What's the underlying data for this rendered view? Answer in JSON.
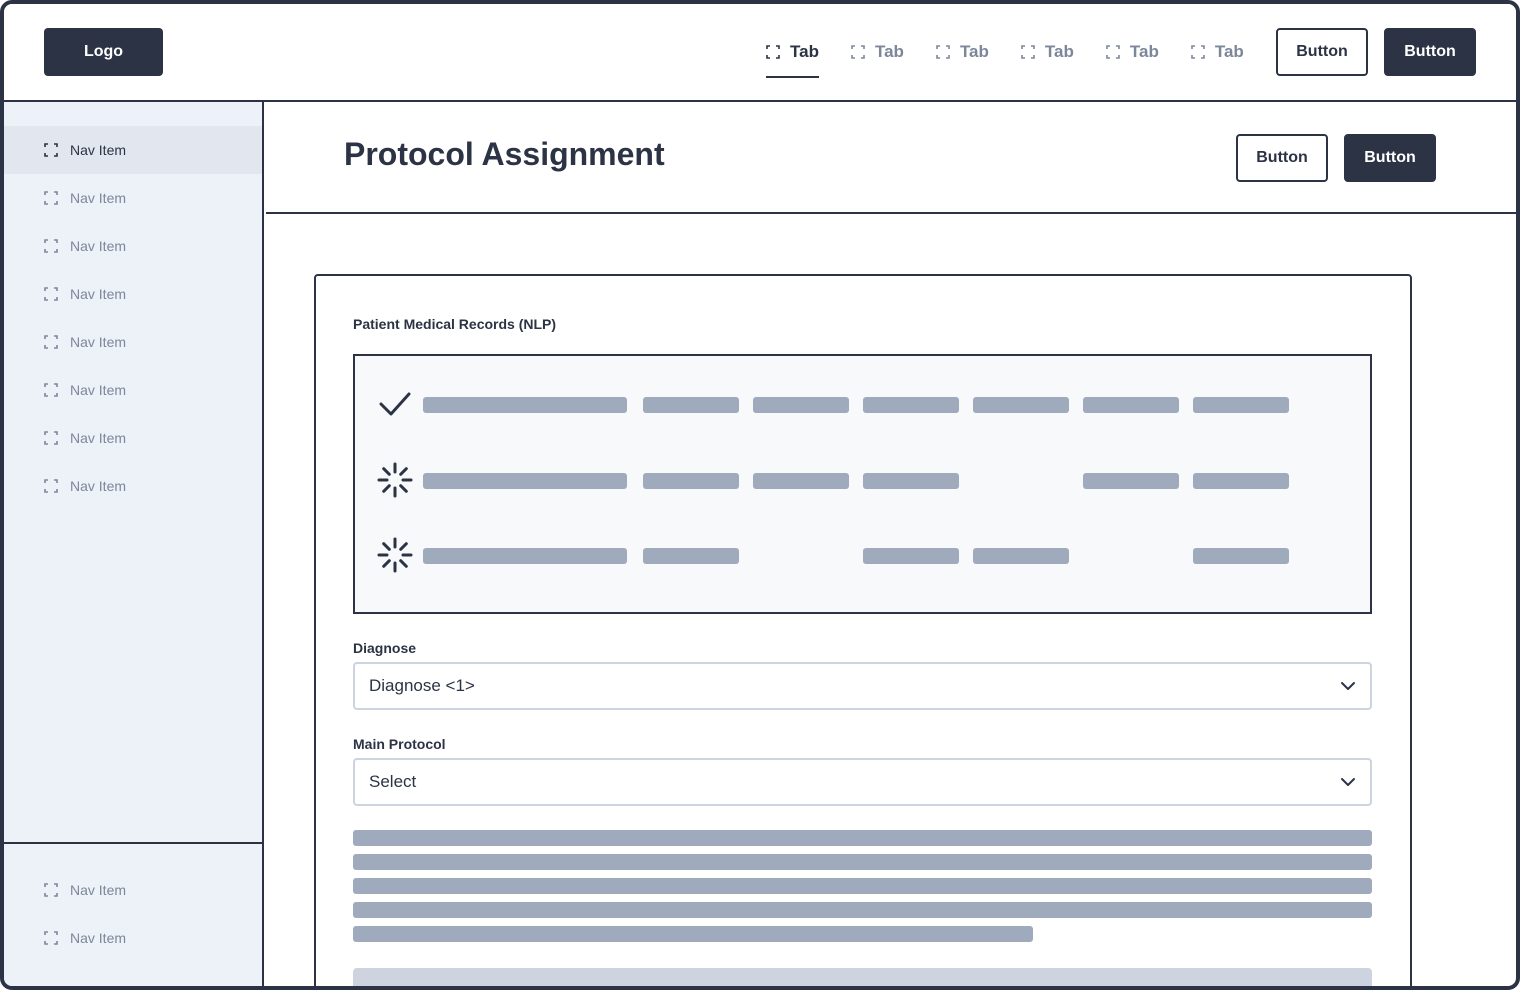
{
  "header": {
    "logo": "Logo",
    "tabs": [
      {
        "label": "Tab",
        "active": true
      },
      {
        "label": "Tab",
        "active": false
      },
      {
        "label": "Tab",
        "active": false
      },
      {
        "label": "Tab",
        "active": false
      },
      {
        "label": "Tab",
        "active": false
      },
      {
        "label": "Tab",
        "active": false
      }
    ],
    "secondary_button": "Button",
    "primary_button": "Button"
  },
  "sidebar": {
    "items": [
      {
        "label": "Nav Item",
        "active": true
      },
      {
        "label": "Nav Item"
      },
      {
        "label": "Nav Item"
      },
      {
        "label": "Nav Item"
      },
      {
        "label": "Nav Item"
      },
      {
        "label": "Nav Item"
      },
      {
        "label": "Nav Item"
      },
      {
        "label": "Nav Item"
      }
    ],
    "bottom_items": [
      {
        "label": "Nav Item"
      },
      {
        "label": "Nav Item"
      }
    ]
  },
  "page": {
    "title": "Protocol Assignment",
    "secondary_button": "Button",
    "primary_button": "Button"
  },
  "card": {
    "records_label": "Patient Medical Records (NLP)",
    "records": [
      {
        "status": "done"
      },
      {
        "status": "loading"
      },
      {
        "status": "loading"
      }
    ],
    "diagnose_label": "Diagnose",
    "diagnose_value": "Diagnose <1>",
    "protocol_label": "Main Protocol",
    "protocol_value": "Select"
  },
  "colors": {
    "primary": "#2b3344",
    "muted_text": "#7d879a",
    "sidebar_bg": "#edf1f8",
    "skeleton": "#a0aabd"
  },
  "icons": {
    "tab": "focus-bracket-icon",
    "nav": "focus-bracket-icon",
    "record_done": "checkmark-icon",
    "record_loading": "spinner-icon",
    "select": "chevron-down-icon"
  }
}
